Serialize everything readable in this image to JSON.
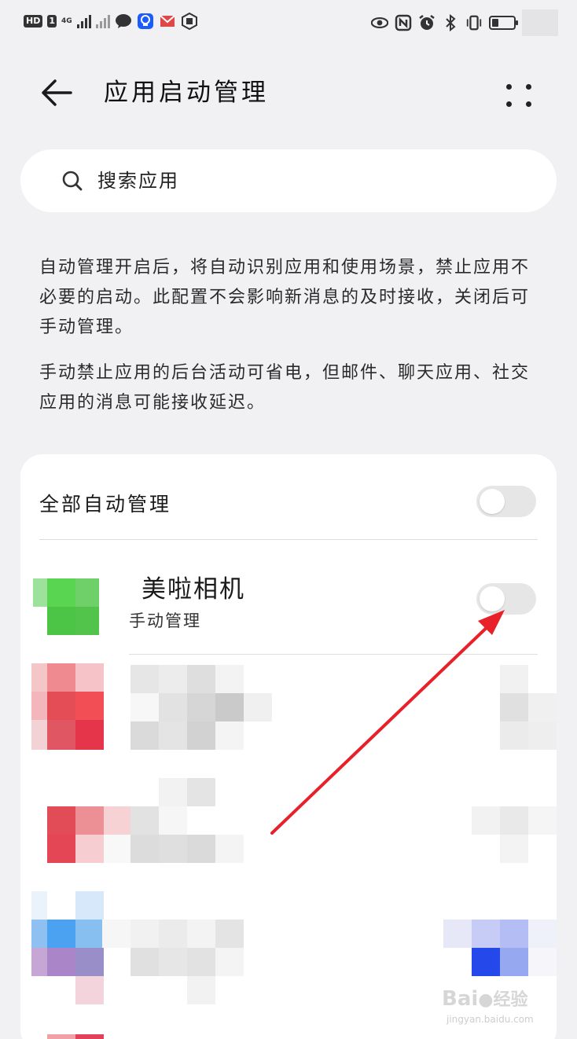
{
  "status_bar": {
    "left_badge": "HD",
    "network": "4G",
    "icons_left": [
      "wechat-icon",
      "bulb-icon",
      "mail-icon",
      "hand-icon"
    ],
    "icons_right": [
      "eye-icon",
      "nfc-icon",
      "alarm-icon",
      "bluetooth-icon",
      "vibrate-icon",
      "battery-icon"
    ],
    "battery_level": 0.3
  },
  "header": {
    "title": "应用启动管理"
  },
  "search": {
    "placeholder": "搜索应用"
  },
  "description": {
    "para1": "自动管理开启后，将自动识别应用和使用场景，禁止应用不必要的启动。此配置不会影响新消息的及时接收，关闭后可手动管理。",
    "para2": "手动禁止应用的后台活动可省电，但邮件、聊天应用、社交应用的消息可能接收延迟。"
  },
  "card": {
    "all_auto_label": "全部自动管理",
    "all_auto_on": false,
    "apps": [
      {
        "name": "美啦相机",
        "mode": "手动管理",
        "auto_on": false
      }
    ]
  },
  "watermark": {
    "brand": "Bai",
    "brand_suffix": "经验",
    "url": "jingyan.baidu.com"
  },
  "colors": {
    "background": "#f1f1f3",
    "card": "#ffffff",
    "arrow": "#e8202a",
    "toggle_off": "#e6e6e6"
  }
}
